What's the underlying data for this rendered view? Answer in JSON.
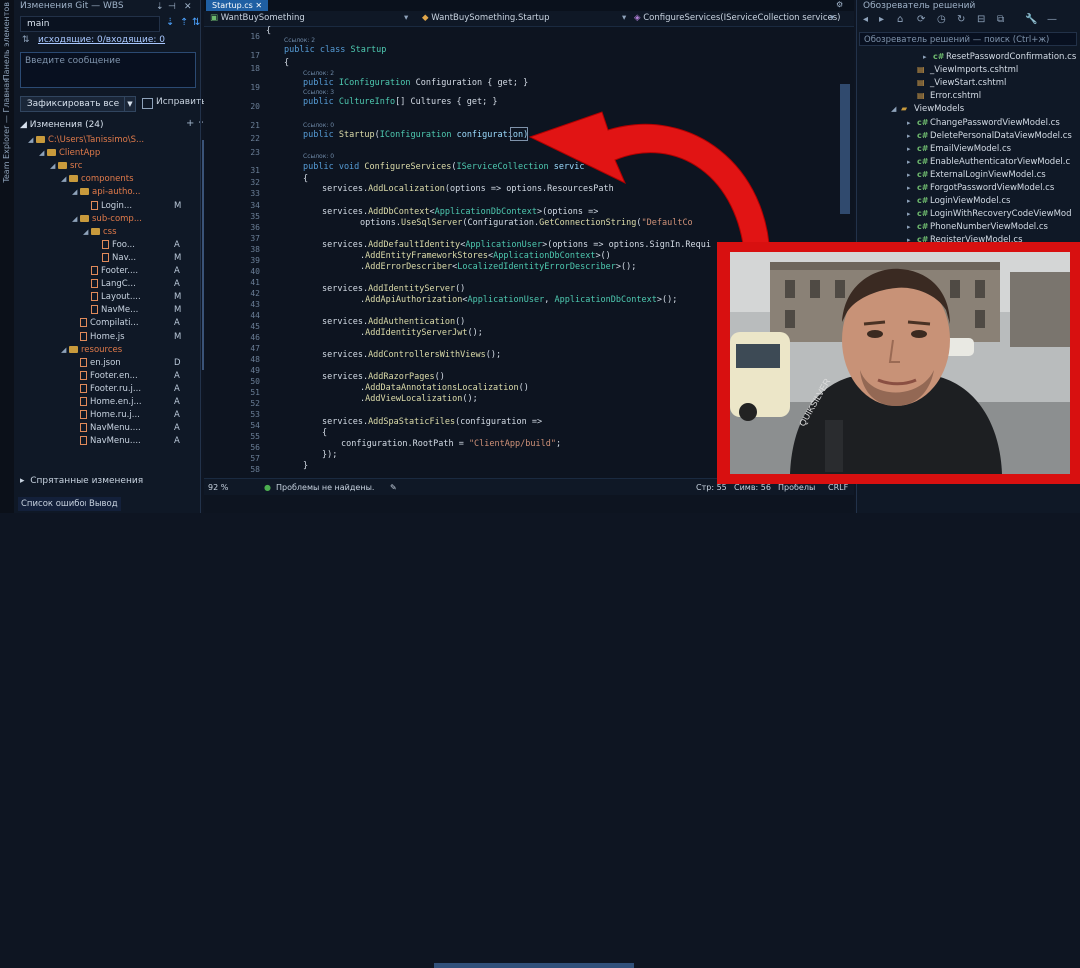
{
  "left_strip": {
    "tab1": "Панель элементов",
    "tab2": "Team Explorer — Главная"
  },
  "git": {
    "title": "Изменения Git — WBS",
    "branch": "main",
    "sync": "исходящие: 0/входящие: 0",
    "message_placeholder": "Введите сообщение",
    "commit_label": "Зафиксировать все",
    "amend_label": "Исправить",
    "changes_header": "Изменения (24)",
    "tree": [
      {
        "indent": 0,
        "kind": "folder",
        "label": "C:\\Users\\Tanissimo\\S...",
        "status": ""
      },
      {
        "indent": 1,
        "kind": "folder",
        "label": "ClientApp",
        "status": ""
      },
      {
        "indent": 2,
        "kind": "folder",
        "label": "src",
        "status": ""
      },
      {
        "indent": 3,
        "kind": "folder",
        "label": "components",
        "status": ""
      },
      {
        "indent": 4,
        "kind": "folder",
        "label": "api-autho...",
        "status": ""
      },
      {
        "indent": 5,
        "kind": "file",
        "label": "Login...",
        "status": "M"
      },
      {
        "indent": 4,
        "kind": "folder",
        "label": "sub-comp...",
        "status": ""
      },
      {
        "indent": 5,
        "kind": "folder",
        "label": "css",
        "status": ""
      },
      {
        "indent": 6,
        "kind": "file",
        "label": "Foo...",
        "status": "A"
      },
      {
        "indent": 6,
        "kind": "file",
        "label": "Nav...",
        "status": "M"
      },
      {
        "indent": 5,
        "kind": "file",
        "label": "Footer....",
        "status": "A"
      },
      {
        "indent": 5,
        "kind": "file",
        "label": "LangC...",
        "status": "A"
      },
      {
        "indent": 5,
        "kind": "file",
        "label": "Layout....",
        "status": "M"
      },
      {
        "indent": 5,
        "kind": "file",
        "label": "NavMe...",
        "status": "M"
      },
      {
        "indent": 4,
        "kind": "file",
        "label": "Compilati...",
        "status": "A"
      },
      {
        "indent": 4,
        "kind": "file",
        "label": "Home.js",
        "status": "M"
      },
      {
        "indent": 3,
        "kind": "folder",
        "label": "resources",
        "status": ""
      },
      {
        "indent": 4,
        "kind": "file",
        "label": "en.json",
        "status": "D"
      },
      {
        "indent": 4,
        "kind": "file",
        "label": "Footer.en...",
        "status": "A"
      },
      {
        "indent": 4,
        "kind": "file",
        "label": "Footer.ru.j...",
        "status": "A"
      },
      {
        "indent": 4,
        "kind": "file",
        "label": "Home.en.j...",
        "status": "A"
      },
      {
        "indent": 4,
        "kind": "file",
        "label": "Home.ru.j...",
        "status": "A"
      },
      {
        "indent": 4,
        "kind": "file",
        "label": "NavMenu....",
        "status": "A"
      },
      {
        "indent": 4,
        "kind": "file",
        "label": "NavMenu....",
        "status": "A"
      }
    ],
    "hidden_changes": "Спрятанные изменения",
    "bottom_tabs": [
      "Список ошибок",
      "Вывод"
    ]
  },
  "editor": {
    "tab": "Startup.cs",
    "nav_project": "WantBuySomething",
    "nav_class": "WantBuySomething.Startup",
    "nav_member": "ConfigureServices(IServiceCollection services)",
    "lines": [
      "16",
      "17",
      "18",
      "19",
      "20",
      "21",
      "22",
      "23",
      "31",
      "32",
      "33",
      "34",
      "35",
      "36",
      "37",
      "38",
      "39",
      "40",
      "41",
      "42",
      "43",
      "44",
      "45",
      "46",
      "47",
      "48",
      "49",
      "50",
      "51",
      "52",
      "53",
      "54",
      "55",
      "56",
      "57",
      "58",
      "59",
      "60"
    ],
    "refs": {
      "r17": "Ссылок: 2",
      "r19": "Ссылок: 2",
      "r21": "Ссылок: 3",
      "r22": "Ссылок: 0",
      "r32": "Ссылок: 0"
    },
    "code": {
      "c16": "{",
      "c17a": "public class",
      "c17b": "Startup",
      "c18": "{",
      "c19a": "public",
      "c19b": "IConfiguration",
      "c19c": "Configuration { get; }",
      "c20a": "public",
      "c20b": "CultureInfo",
      "c20c": "[] Cultures { get; }",
      "c22a": "public",
      "c22b": "Startup",
      "c22c": "(",
      "c22d": "IConfiguration",
      "c22e": "configuration)",
      "c31a": "public void",
      "c31b": "ConfigureServices",
      "c31c": "(",
      "c31d": "IServiceCollection",
      "c31e": "servic",
      "c32": "{",
      "c33a": "services.",
      "c33b": "AddLocalization",
      "c33c": "(options => options.ResourcesPath",
      "c35a": "services.",
      "c35b": "AddDbContext",
      "c35c": "<",
      "c35d": "ApplicationDbContext",
      "c35e": ">(options =>",
      "c36a": "options.",
      "c36b": "UseSqlServer",
      "c36c": "(Configuration.",
      "c36d": "GetConnectionString",
      "c36e": "(",
      "c36f": "\"DefaultCo",
      "c38a": "services.",
      "c38b": "AddDefaultIdentity",
      "c38c": "<",
      "c38d": "ApplicationUser",
      "c38e": ">(options => options.SignIn.Requi",
      "c39a": ".",
      "c39b": "AddEntityFrameworkStores",
      "c39c": "<",
      "c39d": "ApplicationDbContext",
      "c39e": ">()",
      "c40a": ".",
      "c40b": "AddErrorDescriber",
      "c40c": "<",
      "c40d": "LocalizedIdentityErrorDescriber",
      "c40e": ">();",
      "c42a": "services.",
      "c42b": "AddIdentityServer",
      "c42c": "()",
      "c43a": ".",
      "c43b": "AddApiAuthorization",
      "c43c": "<",
      "c43d": "ApplicationUser",
      "c43e": ", ",
      "c43f": "ApplicationDbContext",
      "c43g": ">();",
      "c45a": "services.",
      "c45b": "AddAuthentication",
      "c45c": "()",
      "c46a": ".",
      "c46b": "AddIdentityServerJwt",
      "c46c": "();",
      "c48a": "services.",
      "c48b": "AddControllersWithViews",
      "c48c": "();",
      "c50a": "services.",
      "c50b": "AddRazorPages",
      "c50c": "()",
      "c51a": ".",
      "c51b": "AddDataAnnotationsLocalization",
      "c51c": "()",
      "c52a": ".",
      "c52b": "AddViewLocalization",
      "c52c": "();",
      "c54a": "services.",
      "c54b": "AddSpaStaticFiles",
      "c54c": "(configuration =>",
      "c55": "{",
      "c56a": "configuration.RootPath = ",
      "c56b": "\"ClientApp/build\"",
      "c56c": ";",
      "c57": "});",
      "c58": "}"
    },
    "zoom": "92 %",
    "problems": "Проблемы не найдены.",
    "line_info": "Стр: 55",
    "col_info": "Симв: 56",
    "spaces": "Пробелы",
    "eol": "CRLF"
  },
  "solution": {
    "title": "Обозреватель решений",
    "search_placeholder": "Обозреватель решений — поиск (Ctrl+ж)",
    "items": [
      {
        "indent": 4,
        "type": "cs",
        "label": "ResetPasswordConfirmation.cs"
      },
      {
        "indent": 3,
        "type": "cshtml",
        "label": "_ViewImports.cshtml"
      },
      {
        "indent": 3,
        "type": "cshtml",
        "label": "_ViewStart.cshtml"
      },
      {
        "indent": 3,
        "type": "cshtml",
        "label": "Error.cshtml"
      },
      {
        "indent": 2,
        "type": "folder",
        "label": "ViewModels"
      },
      {
        "indent": 3,
        "type": "cs",
        "label": "ChangePasswordViewModel.cs"
      },
      {
        "indent": 3,
        "type": "cs",
        "label": "DeletePersonalDataViewModel.cs"
      },
      {
        "indent": 3,
        "type": "cs",
        "label": "EmailViewModel.cs"
      },
      {
        "indent": 3,
        "type": "cs",
        "label": "EnableAuthenticatorViewModel.c"
      },
      {
        "indent": 3,
        "type": "cs",
        "label": "ExternalLoginViewModel.cs"
      },
      {
        "indent": 3,
        "type": "cs",
        "label": "ForgotPasswordViewModel.cs"
      },
      {
        "indent": 3,
        "type": "cs",
        "label": "LoginViewModel.cs"
      },
      {
        "indent": 3,
        "type": "cs",
        "label": "LoginWithRecoveryCodeViewMod"
      },
      {
        "indent": 3,
        "type": "cs",
        "label": "PhoneNumberViewModel.cs"
      },
      {
        "indent": 3,
        "type": "cs",
        "label": "RegisterViewModel.cs"
      }
    ]
  },
  "photo": {
    "jacket_text": "QUIKSILVER"
  },
  "colors": {
    "accent": "#1f5fa3",
    "overlay_red": "#d81010"
  }
}
